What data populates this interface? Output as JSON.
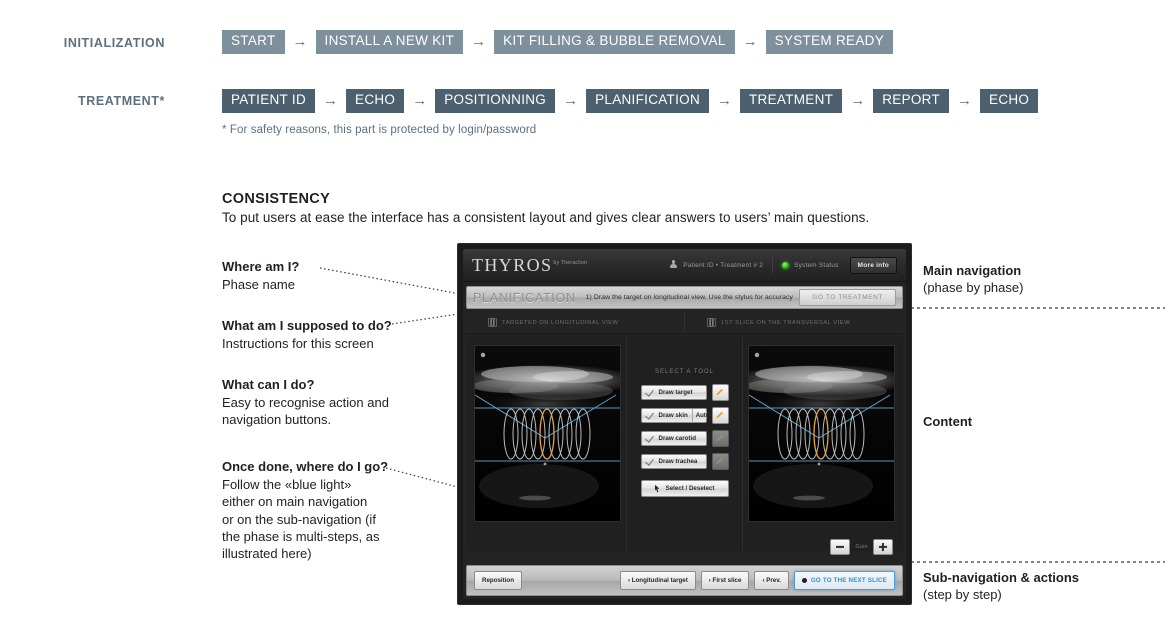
{
  "flows": [
    {
      "label": "INITIALIZATION",
      "style": "light",
      "steps": [
        "START",
        "INSTALL A NEW KIT",
        "KIT FILLING & BUBBLE REMOVAL",
        "SYSTEM READY"
      ]
    },
    {
      "label": "TREATMENT*",
      "style": "dark",
      "steps": [
        "PATIENT  ID",
        "ECHO",
        "POSITIONNING",
        "PLANIFICATION",
        "TREATMENT",
        "REPORT",
        "ECHO"
      ],
      "footnote": "* For safety reasons, this part is protected by login/password"
    }
  ],
  "arrow_glyph": "→",
  "section": {
    "title": "CONSISTENCY",
    "subtitle": "To put users at ease the interface has a consistent layout and gives clear answers to users’ main questions."
  },
  "annotations_left": [
    {
      "question": "Where am I?",
      "answer": "Phase name"
    },
    {
      "question": "What am I supposed to do?",
      "answer": "Instructions for this screen"
    },
    {
      "question": "What can I do?",
      "answer": "Easy to recognise action and\nnavigation buttons."
    },
    {
      "question": "Once done, where do I go?",
      "answer": "Follow the «blue light»\neither on main navigation\nor on the sub-navigation (if\nthe phase is multi-steps, as\nillustrated here)"
    }
  ],
  "annotations_right": [
    {
      "title": "Main navigation",
      "subtitle": "(phase by phase)"
    },
    {
      "title": "Content",
      "subtitle": ""
    },
    {
      "title": "Sub-navigation & actions",
      "subtitle": "(step by step)"
    }
  ],
  "mockup": {
    "header": {
      "logo": "THYROS",
      "logo_sup": "by Theraclion",
      "patient": "Patient ID • Treatment # 2",
      "system_status": "System Status",
      "more_info": "More info"
    },
    "nav": {
      "phase": "PLANIFICATION",
      "instruction": "1) Draw the target on longitudinal view. Use the stylus for accuracy",
      "action": "GO TO TREATMENT"
    },
    "tabs": [
      {
        "label": "TARGETED ON LONGITUDINAL VIEW"
      },
      {
        "label": "1ST SLICE ON THE TRANSVERSAL VIEW"
      }
    ],
    "tools": {
      "title": "SELECT A TOOL",
      "items": [
        {
          "label": "Draw target",
          "segment": "",
          "pen_enabled": true
        },
        {
          "label": "Draw skin",
          "segment": "Auto",
          "pen_enabled": true
        },
        {
          "label": "Draw carotid",
          "segment": "",
          "pen_enabled": false
        },
        {
          "label": "Draw trachea",
          "segment": "",
          "pen_enabled": false
        }
      ],
      "select_label": "Select / Deselect"
    },
    "gain": {
      "label": "Gain",
      "minus": "−",
      "plus": "+"
    },
    "bottom": {
      "reposition": "Reposition",
      "longitudinal": "‹ Longitudinal target",
      "first_slice": "‹ First slice",
      "prev": "‹ Prev.",
      "next": "GO TO THE NEXT SLICE"
    }
  },
  "colors": {
    "chip_light": "#7d909b",
    "chip_dark": "#4d6070",
    "flow_label": "#5d7080",
    "highlight_blue": "#2f8fd4",
    "target_orange": "#e8a33d",
    "status_green": "#37c41c"
  }
}
